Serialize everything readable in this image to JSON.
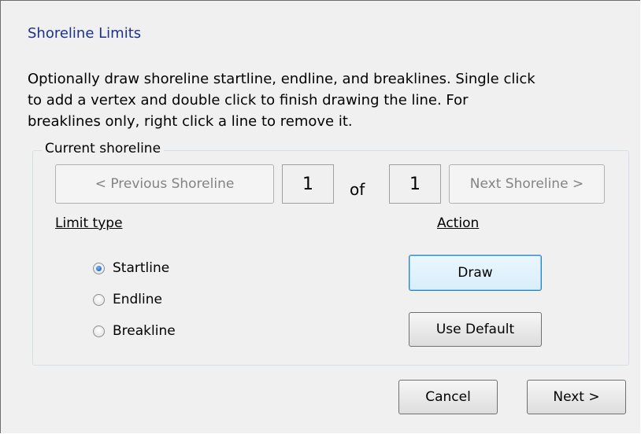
{
  "dialog": {
    "title": "Shoreline Limits",
    "instructions": "Optionally draw shoreline startline, endline, and breaklines.  Single click\nto add a vertex and double click to finish drawing the line.  For\nbreaklines only, right click a line to remove it."
  },
  "group": {
    "label": "Current shoreline",
    "previous_label": "< Previous Shoreline",
    "current_index": "1",
    "of_label": "of",
    "total": "1",
    "next_label": "Next Shoreline >"
  },
  "limit_type": {
    "label": "Limit type",
    "options": [
      {
        "label": "Startline",
        "checked": true
      },
      {
        "label": "Endline",
        "checked": false
      },
      {
        "label": "Breakline",
        "checked": false
      }
    ]
  },
  "action": {
    "label": "Action",
    "draw_label": "Draw",
    "use_default_label": "Use Default"
  },
  "footer": {
    "cancel_label": "Cancel",
    "next_label": "Next >"
  }
}
